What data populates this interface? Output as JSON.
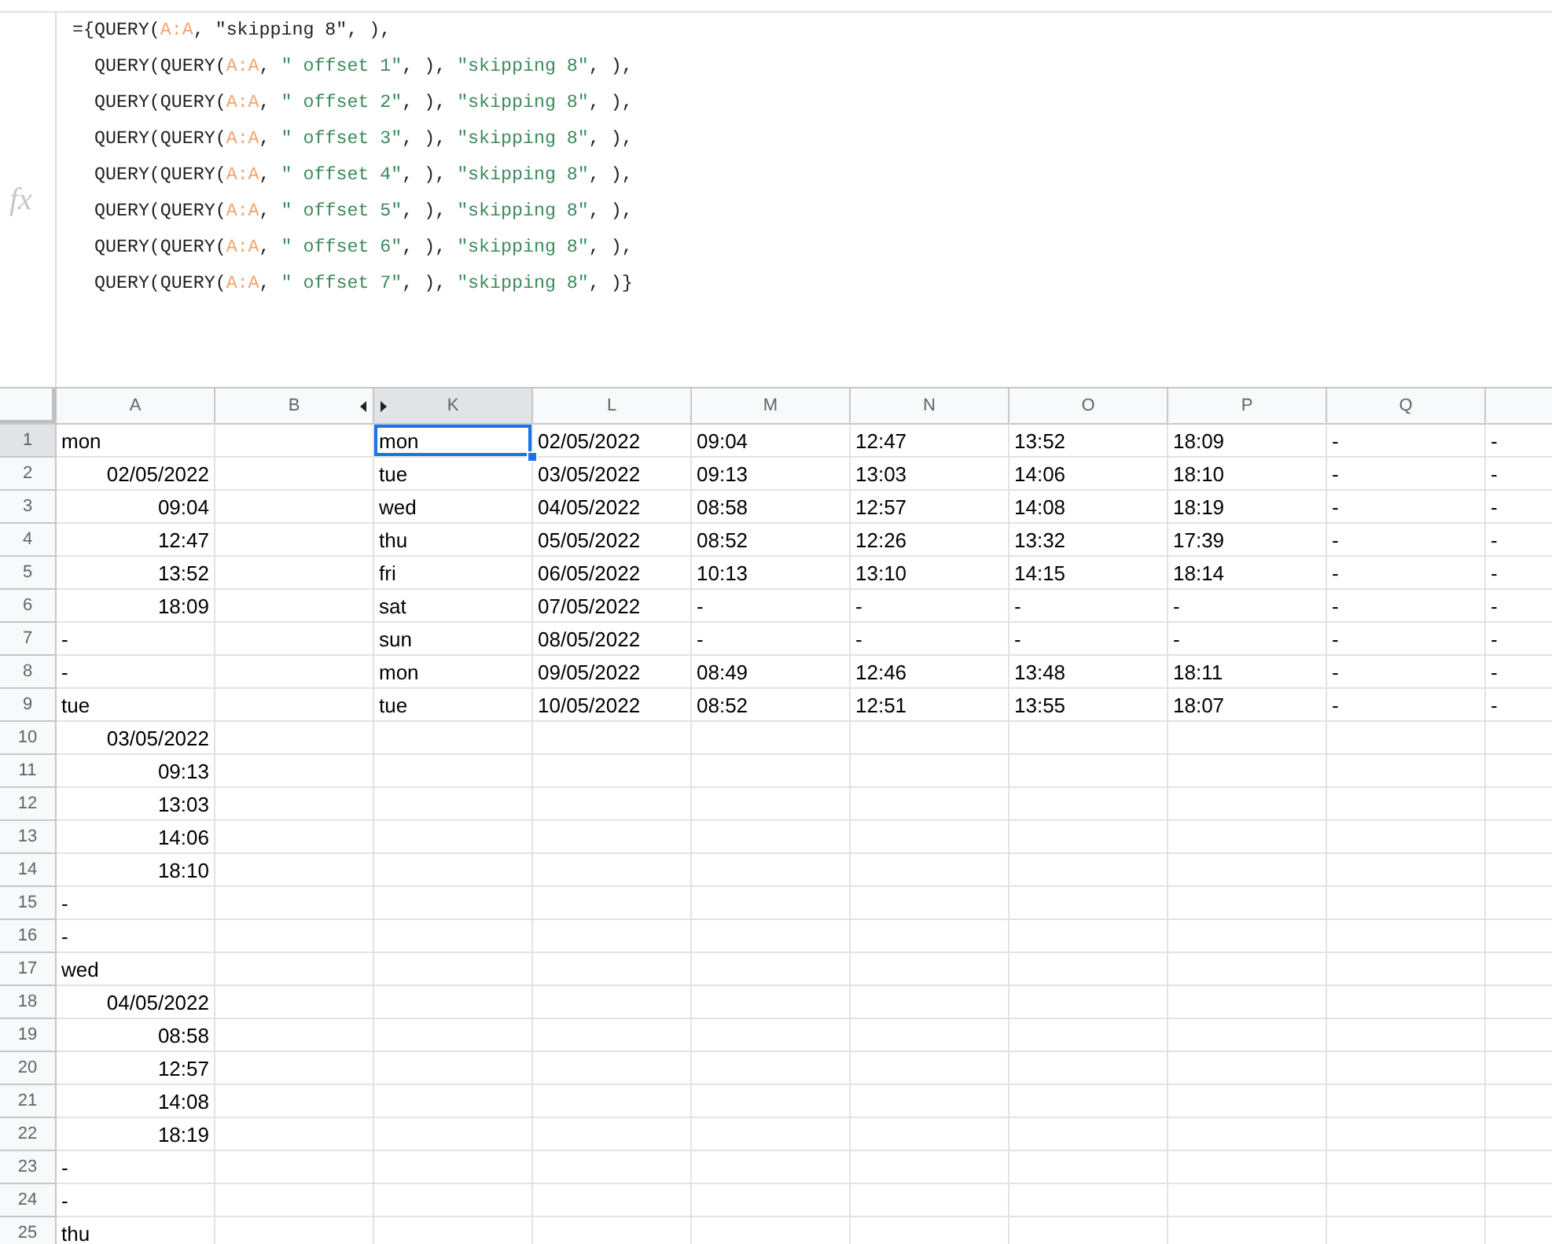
{
  "formula_bar": {
    "fx_label": "fx",
    "lines": [
      {
        "segments": [
          {
            "kind": "plain",
            "text": "={QUERY("
          },
          {
            "kind": "range",
            "text": "A:A"
          },
          {
            "kind": "plain",
            "text": ", \"skipping 8\", ),"
          }
        ]
      },
      {
        "segments": [
          {
            "kind": "plain",
            "text": "QUERY(QUERY("
          },
          {
            "kind": "range",
            "text": "A:A"
          },
          {
            "kind": "plain",
            "text": ", "
          },
          {
            "kind": "string",
            "text": "\" offset 1\""
          },
          {
            "kind": "plain",
            "text": ", ), "
          },
          {
            "kind": "string",
            "text": "\"skipping 8\""
          },
          {
            "kind": "plain",
            "text": ", ),"
          }
        ]
      },
      {
        "segments": [
          {
            "kind": "plain",
            "text": "QUERY(QUERY("
          },
          {
            "kind": "range",
            "text": "A:A"
          },
          {
            "kind": "plain",
            "text": ", "
          },
          {
            "kind": "string",
            "text": "\" offset 2\""
          },
          {
            "kind": "plain",
            "text": ", ), "
          },
          {
            "kind": "string",
            "text": "\"skipping 8\""
          },
          {
            "kind": "plain",
            "text": ", ),"
          }
        ]
      },
      {
        "segments": [
          {
            "kind": "plain",
            "text": "QUERY(QUERY("
          },
          {
            "kind": "range",
            "text": "A:A"
          },
          {
            "kind": "plain",
            "text": ", "
          },
          {
            "kind": "string",
            "text": "\" offset 3\""
          },
          {
            "kind": "plain",
            "text": ", ), "
          },
          {
            "kind": "string",
            "text": "\"skipping 8\""
          },
          {
            "kind": "plain",
            "text": ", ),"
          }
        ]
      },
      {
        "segments": [
          {
            "kind": "plain",
            "text": "QUERY(QUERY("
          },
          {
            "kind": "range",
            "text": "A:A"
          },
          {
            "kind": "plain",
            "text": ", "
          },
          {
            "kind": "string",
            "text": "\" offset 4\""
          },
          {
            "kind": "plain",
            "text": ", ), "
          },
          {
            "kind": "string",
            "text": "\"skipping 8\""
          },
          {
            "kind": "plain",
            "text": ", ),"
          }
        ]
      },
      {
        "segments": [
          {
            "kind": "plain",
            "text": "QUERY(QUERY("
          },
          {
            "kind": "range",
            "text": "A:A"
          },
          {
            "kind": "plain",
            "text": ", "
          },
          {
            "kind": "string",
            "text": "\" offset 5\""
          },
          {
            "kind": "plain",
            "text": ", ), "
          },
          {
            "kind": "string",
            "text": "\"skipping 8\""
          },
          {
            "kind": "plain",
            "text": ", ),"
          }
        ]
      },
      {
        "segments": [
          {
            "kind": "plain",
            "text": "QUERY(QUERY("
          },
          {
            "kind": "range",
            "text": "A:A"
          },
          {
            "kind": "plain",
            "text": ", "
          },
          {
            "kind": "string",
            "text": "\" offset 6\""
          },
          {
            "kind": "plain",
            "text": ", ), "
          },
          {
            "kind": "string",
            "text": "\"skipping 8\""
          },
          {
            "kind": "plain",
            "text": ", ),"
          }
        ]
      },
      {
        "segments": [
          {
            "kind": "plain",
            "text": "QUERY(QUERY("
          },
          {
            "kind": "range",
            "text": "A:A"
          },
          {
            "kind": "plain",
            "text": ", "
          },
          {
            "kind": "string",
            "text": "\" offset 7\""
          },
          {
            "kind": "plain",
            "text": ", ), "
          },
          {
            "kind": "string",
            "text": "\"skipping 8\""
          },
          {
            "kind": "plain",
            "text": ", )}"
          }
        ]
      }
    ]
  },
  "columns": [
    {
      "label": "A",
      "selected": false,
      "hidden_after": false
    },
    {
      "label": "B",
      "selected": false,
      "hidden_after": true
    },
    {
      "label": "K",
      "selected": true,
      "hidden_after": false
    },
    {
      "label": "L",
      "selected": false,
      "hidden_after": false
    },
    {
      "label": "M",
      "selected": false,
      "hidden_after": false
    },
    {
      "label": "N",
      "selected": false,
      "hidden_after": false
    },
    {
      "label": "O",
      "selected": false,
      "hidden_after": false
    },
    {
      "label": "P",
      "selected": false,
      "hidden_after": false
    },
    {
      "label": "Q",
      "selected": false,
      "hidden_after": false
    },
    {
      "selected": false,
      "hidden_after": false
    }
  ],
  "rows": [
    {
      "number": "1",
      "selected": true,
      "cells": [
        {
          "text": "mon",
          "right_aligned": false
        },
        null,
        {
          "text": "mon",
          "right_aligned": false
        },
        {
          "text": "02/05/2022",
          "right_aligned": false
        },
        {
          "text": "09:04",
          "right_aligned": false
        },
        {
          "text": "12:47",
          "right_aligned": false
        },
        {
          "text": "13:52",
          "right_aligned": false
        },
        {
          "text": "18:09",
          "right_aligned": false
        },
        {
          "text": "-",
          "right_aligned": false
        },
        {
          "text": "-",
          "right_aligned": false
        }
      ]
    },
    {
      "number": "2",
      "selected": false,
      "cells": [
        {
          "text": "02/05/2022",
          "right_aligned": true
        },
        null,
        {
          "text": "tue",
          "right_aligned": false
        },
        {
          "text": "03/05/2022",
          "right_aligned": false
        },
        {
          "text": "09:13",
          "right_aligned": false
        },
        {
          "text": "13:03",
          "right_aligned": false
        },
        {
          "text": "14:06",
          "right_aligned": false
        },
        {
          "text": "18:10",
          "right_aligned": false
        },
        {
          "text": "-",
          "right_aligned": false
        },
        {
          "text": "-",
          "right_aligned": false
        }
      ]
    },
    {
      "number": "3",
      "selected": false,
      "cells": [
        {
          "text": "09:04",
          "right_aligned": true
        },
        null,
        {
          "text": "wed",
          "right_aligned": false
        },
        {
          "text": "04/05/2022",
          "right_aligned": false
        },
        {
          "text": "08:58",
          "right_aligned": false
        },
        {
          "text": "12:57",
          "right_aligned": false
        },
        {
          "text": "14:08",
          "right_aligned": false
        },
        {
          "text": "18:19",
          "right_aligned": false
        },
        {
          "text": "-",
          "right_aligned": false
        },
        {
          "text": "-",
          "right_aligned": false
        }
      ]
    },
    {
      "number": "4",
      "selected": false,
      "cells": [
        {
          "text": "12:47",
          "right_aligned": true
        },
        null,
        {
          "text": "thu",
          "right_aligned": false
        },
        {
          "text": "05/05/2022",
          "right_aligned": false
        },
        {
          "text": "08:52",
          "right_aligned": false
        },
        {
          "text": "12:26",
          "right_aligned": false
        },
        {
          "text": "13:32",
          "right_aligned": false
        },
        {
          "text": "17:39",
          "right_aligned": false
        },
        {
          "text": "-",
          "right_aligned": false
        },
        {
          "text": "-",
          "right_aligned": false
        }
      ]
    },
    {
      "number": "5",
      "selected": false,
      "cells": [
        {
          "text": "13:52",
          "right_aligned": true
        },
        null,
        {
          "text": "fri",
          "right_aligned": false
        },
        {
          "text": "06/05/2022",
          "right_aligned": false
        },
        {
          "text": "10:13",
          "right_aligned": false
        },
        {
          "text": "13:10",
          "right_aligned": false
        },
        {
          "text": "14:15",
          "right_aligned": false
        },
        {
          "text": "18:14",
          "right_aligned": false
        },
        {
          "text": "-",
          "right_aligned": false
        },
        {
          "text": "-",
          "right_aligned": false
        }
      ]
    },
    {
      "number": "6",
      "selected": false,
      "cells": [
        {
          "text": "18:09",
          "right_aligned": true
        },
        null,
        {
          "text": "sat",
          "right_aligned": false
        },
        {
          "text": "07/05/2022",
          "right_aligned": false
        },
        {
          "text": "-",
          "right_aligned": false
        },
        {
          "text": "-",
          "right_aligned": false
        },
        {
          "text": "-",
          "right_aligned": false
        },
        {
          "text": "-",
          "right_aligned": false
        },
        {
          "text": "-",
          "right_aligned": false
        },
        {
          "text": "-",
          "right_aligned": false
        }
      ]
    },
    {
      "number": "7",
      "selected": false,
      "cells": [
        {
          "text": "-",
          "right_aligned": false
        },
        null,
        {
          "text": "sun",
          "right_aligned": false
        },
        {
          "text": "08/05/2022",
          "right_aligned": false
        },
        {
          "text": "-",
          "right_aligned": false
        },
        {
          "text": "-",
          "right_aligned": false
        },
        {
          "text": "-",
          "right_aligned": false
        },
        {
          "text": "-",
          "right_aligned": false
        },
        {
          "text": "-",
          "right_aligned": false
        },
        {
          "text": "-",
          "right_aligned": false
        }
      ]
    },
    {
      "number": "8",
      "selected": false,
      "cells": [
        {
          "text": "-",
          "right_aligned": false
        },
        null,
        {
          "text": "mon",
          "right_aligned": false
        },
        {
          "text": "09/05/2022",
          "right_aligned": false
        },
        {
          "text": "08:49",
          "right_aligned": false
        },
        {
          "text": "12:46",
          "right_aligned": false
        },
        {
          "text": "13:48",
          "right_aligned": false
        },
        {
          "text": "18:11",
          "right_aligned": false
        },
        {
          "text": "-",
          "right_aligned": false
        },
        {
          "text": "-",
          "right_aligned": false
        }
      ]
    },
    {
      "number": "9",
      "selected": false,
      "cells": [
        {
          "text": "tue",
          "right_aligned": false
        },
        null,
        {
          "text": "tue",
          "right_aligned": false
        },
        {
          "text": "10/05/2022",
          "right_aligned": false
        },
        {
          "text": "08:52",
          "right_aligned": false
        },
        {
          "text": "12:51",
          "right_aligned": false
        },
        {
          "text": "13:55",
          "right_aligned": false
        },
        {
          "text": "18:07",
          "right_aligned": false
        },
        {
          "text": "-",
          "right_aligned": false
        },
        {
          "text": "-",
          "right_aligned": false
        }
      ]
    },
    {
      "number": "10",
      "selected": false,
      "cells": [
        {
          "text": "03/05/2022",
          "right_aligned": true
        }
      ]
    },
    {
      "number": "11",
      "selected": false,
      "cells": [
        {
          "text": "09:13",
          "right_aligned": true
        }
      ]
    },
    {
      "number": "12",
      "selected": false,
      "cells": [
        {
          "text": "13:03",
          "right_aligned": true
        }
      ]
    },
    {
      "number": "13",
      "selected": false,
      "cells": [
        {
          "text": "14:06",
          "right_aligned": true
        }
      ]
    },
    {
      "number": "14",
      "selected": false,
      "cells": [
        {
          "text": "18:10",
          "right_aligned": true
        }
      ]
    },
    {
      "number": "15",
      "selected": false,
      "cells": [
        {
          "text": "-",
          "right_aligned": false
        }
      ]
    },
    {
      "number": "16",
      "selected": false,
      "cells": [
        {
          "text": "-",
          "right_aligned": false
        }
      ]
    },
    {
      "number": "17",
      "selected": false,
      "cells": [
        {
          "text": "wed",
          "right_aligned": false
        }
      ]
    },
    {
      "number": "18",
      "selected": false,
      "cells": [
        {
          "text": "04/05/2022",
          "right_aligned": true
        }
      ]
    },
    {
      "number": "19",
      "selected": false,
      "cells": [
        {
          "text": "08:58",
          "right_aligned": true
        }
      ]
    },
    {
      "number": "20",
      "selected": false,
      "cells": [
        {
          "text": "12:57",
          "right_aligned": true
        }
      ]
    },
    {
      "number": "21",
      "selected": false,
      "cells": [
        {
          "text": "14:08",
          "right_aligned": true
        }
      ]
    },
    {
      "number": "22",
      "selected": false,
      "cells": [
        {
          "text": "18:19",
          "right_aligned": true
        }
      ]
    },
    {
      "number": "23",
      "selected": false,
      "cells": [
        {
          "text": "-",
          "right_aligned": false
        }
      ]
    },
    {
      "number": "24",
      "selected": false,
      "cells": [
        {
          "text": "-",
          "right_aligned": false
        }
      ]
    },
    {
      "number": "25",
      "selected": false,
      "cells": [
        {
          "text": "thu",
          "right_aligned": false
        }
      ]
    }
  ]
}
